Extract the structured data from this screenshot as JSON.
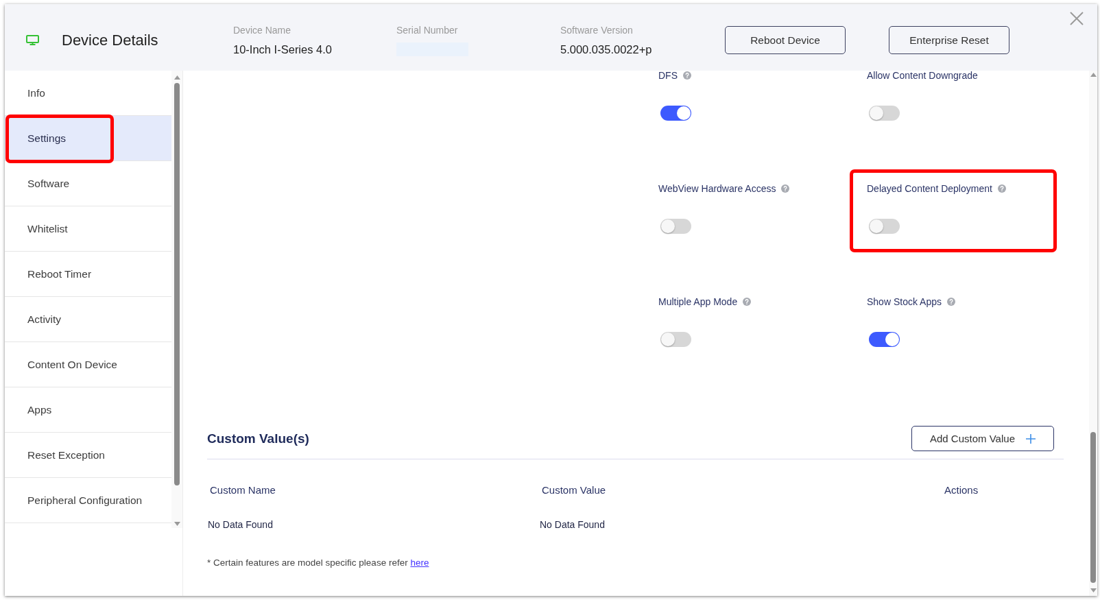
{
  "header": {
    "title": "Device Details",
    "fields": [
      {
        "label": "Device Name",
        "value": "10-Inch I-Series 4.0",
        "redacted": false
      },
      {
        "label": "Serial Number",
        "redacted": true
      },
      {
        "label": "Software Version",
        "value": "5.000.035.0022+p",
        "redacted": false
      }
    ],
    "buttons": [
      "Reboot Device",
      "Enterprise Reset"
    ]
  },
  "sidebar": {
    "items": [
      {
        "label": "Info",
        "selected": false,
        "highlighted": false
      },
      {
        "label": "Settings",
        "selected": true,
        "highlighted": true
      },
      {
        "label": "Software",
        "selected": false,
        "highlighted": false
      },
      {
        "label": "Whitelist",
        "selected": false,
        "highlighted": false
      },
      {
        "label": "Reboot Timer",
        "selected": false,
        "highlighted": false
      },
      {
        "label": "Activity",
        "selected": false,
        "highlighted": false
      },
      {
        "label": "Content On Device",
        "selected": false,
        "highlighted": false
      },
      {
        "label": "Apps",
        "selected": false,
        "highlighted": false
      },
      {
        "label": "Reset Exception",
        "selected": false,
        "highlighted": false
      },
      {
        "label": "Peripheral Configuration",
        "selected": false,
        "highlighted": false
      }
    ]
  },
  "settings": [
    {
      "label": "DFS",
      "help": true,
      "on": true,
      "highlighted": false
    },
    {
      "label": "Allow Content Downgrade",
      "help": false,
      "on": false,
      "highlighted": false
    },
    {
      "label": "WebView Hardware Access",
      "help": true,
      "on": false,
      "highlighted": false
    },
    {
      "label": "Delayed Content Deployment",
      "help": true,
      "on": false,
      "highlighted": true
    },
    {
      "label": "Multiple App Mode",
      "help": true,
      "on": false,
      "highlighted": false
    },
    {
      "label": "Show Stock Apps",
      "help": true,
      "on": true,
      "highlighted": false
    }
  ],
  "custom_values": {
    "title": "Custom Value(s)",
    "add_button": "Add Custom Value",
    "columns": [
      "Custom Name",
      "Custom Value",
      "Actions"
    ],
    "rows": [
      {
        "cells": [
          "No Data Found",
          "No Data Found"
        ]
      }
    ]
  },
  "footnote": {
    "text": "* Certain features are model specific please refer",
    "link": "here"
  }
}
